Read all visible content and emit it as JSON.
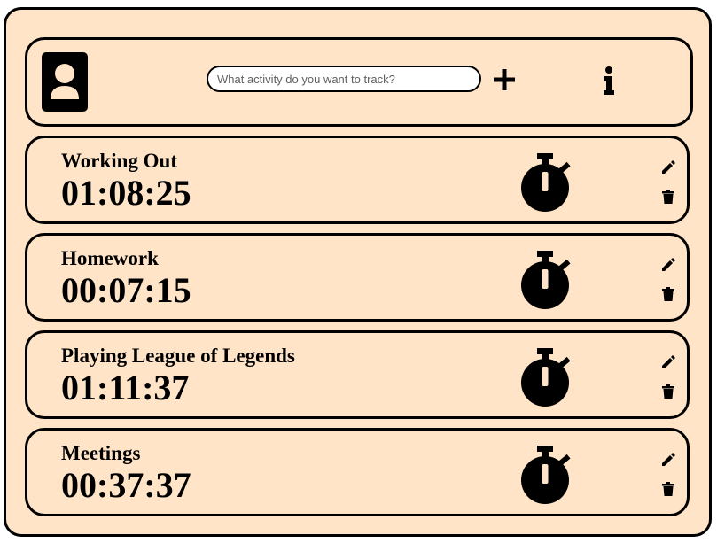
{
  "header": {
    "profile_icon": "user-profile-icon",
    "search": {
      "placeholder": "What activity do you want to track?",
      "value": ""
    },
    "add_icon": "plus-icon",
    "info_icon": "info-icon"
  },
  "activities": [
    {
      "name": "Working Out",
      "time": "01:08:25"
    },
    {
      "name": "Homework",
      "time": "00:07:15"
    },
    {
      "name": "Playing League of Legends",
      "time": "01:11:37"
    },
    {
      "name": "Meetings",
      "time": "00:37:37"
    }
  ],
  "icons": {
    "timer": "stopwatch-icon",
    "edit": "pencil-icon",
    "delete": "trash-icon"
  },
  "colors": {
    "background": "#ffe4c7",
    "border": "#000000",
    "input_background": "#ffffff"
  }
}
